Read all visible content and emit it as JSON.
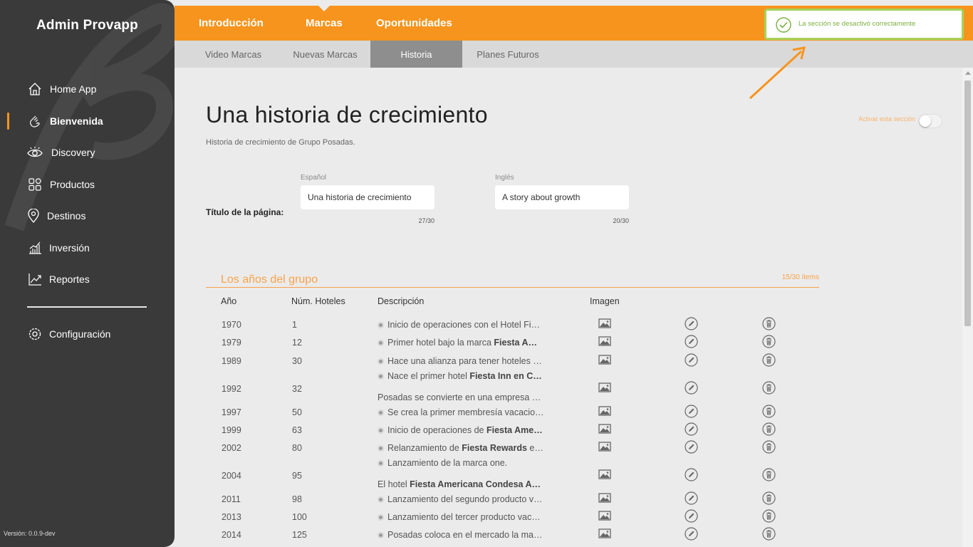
{
  "sidebar": {
    "app_title": "Admin Provapp",
    "items": [
      {
        "label": "Home App",
        "icon": "home-icon"
      },
      {
        "label": "Bienvenida",
        "icon": "wave-hand-icon",
        "active": true
      },
      {
        "label": "Discovery",
        "icon": "eye-icon"
      },
      {
        "label": "Productos",
        "icon": "grid-icon"
      },
      {
        "label": "Destinos",
        "icon": "map-pin-icon"
      },
      {
        "label": "Inversión",
        "icon": "bar-chart-icon"
      },
      {
        "label": "Reportes",
        "icon": "trend-chart-icon"
      }
    ],
    "settings": {
      "label": "Configuración",
      "icon": "gear-icon"
    },
    "version": "Versión: 0.0.9-dev"
  },
  "topnav": {
    "tabs": [
      "Introducción",
      "Marcas",
      "Oportunidades"
    ],
    "active": "Marcas"
  },
  "subnav": {
    "tabs": [
      "Video Marcas",
      "Nuevas Marcas",
      "Historia",
      "Planes Futuros"
    ],
    "active": "Historia"
  },
  "toast": {
    "message": "La sección se desactivó correctamente",
    "status_color": "#a6d35b"
  },
  "page": {
    "title": "Una historia de crecimiento",
    "subtitle": "Historia de crecimiento de Grupo Posadas.",
    "toggle_label": "Activar esta sección",
    "toggle_on": false
  },
  "title_field": {
    "label": "Título de la página:",
    "es": {
      "lang": "Español",
      "value": "Una historia de crecimiento",
      "counter": "27/30"
    },
    "en": {
      "lang": "Inglés",
      "value": "A story about growth",
      "counter": "20/30"
    }
  },
  "years": {
    "title": "Los años del grupo",
    "count": "15/30 ítems",
    "headers": {
      "year": "Año",
      "hotels": "Núm. Hoteles",
      "description": "Descripción",
      "image": "Imagen"
    },
    "rows": [
      {
        "year": "1970",
        "hotels": "1",
        "desc": [
          "Inicio de operaciones con el Hotel Fi…"
        ]
      },
      {
        "year": "1979",
        "hotels": "12",
        "desc": [
          "Primer hotel bajo la marca |Fiesta A…"
        ]
      },
      {
        "year": "1989",
        "hotels": "30",
        "desc": [
          "Hace una alianza para tener hoteles …"
        ]
      },
      {
        "year": "1992",
        "hotels": "32",
        "desc": [
          "Nace el primer hotel |Fiesta Inn en C…",
          "Posadas se convierte en una empresa …"
        ]
      },
      {
        "year": "1997",
        "hotels": "50",
        "desc": [
          "Se crea la primer membresía vacacio…"
        ]
      },
      {
        "year": "1999",
        "hotels": "63",
        "desc": [
          "Inicio de operaciones de |Fiesta Ame…"
        ]
      },
      {
        "year": "2002",
        "hotels": "80",
        "desc": [
          "Relanzamiento de |Fiesta Rewards| e…"
        ]
      },
      {
        "year": "2004",
        "hotels": "95",
        "desc": [
          "Lanzamiento de la marca one.",
          "El hotel |Fiesta Americana Condesa A…"
        ]
      },
      {
        "year": "2011",
        "hotels": "98",
        "desc": [
          "Lanzamiento del segundo producto v…"
        ]
      },
      {
        "year": "2013",
        "hotels": "100",
        "desc": [
          "Lanzamiento del tercer producto vac…"
        ]
      },
      {
        "year": "2014",
        "hotels": "125",
        "desc": [
          "Posadas coloca en el mercado la ma…"
        ]
      }
    ]
  },
  "colors": {
    "accent": "#f7941d",
    "sidebar": "#3a3a3a",
    "success": "#7ab03d"
  }
}
